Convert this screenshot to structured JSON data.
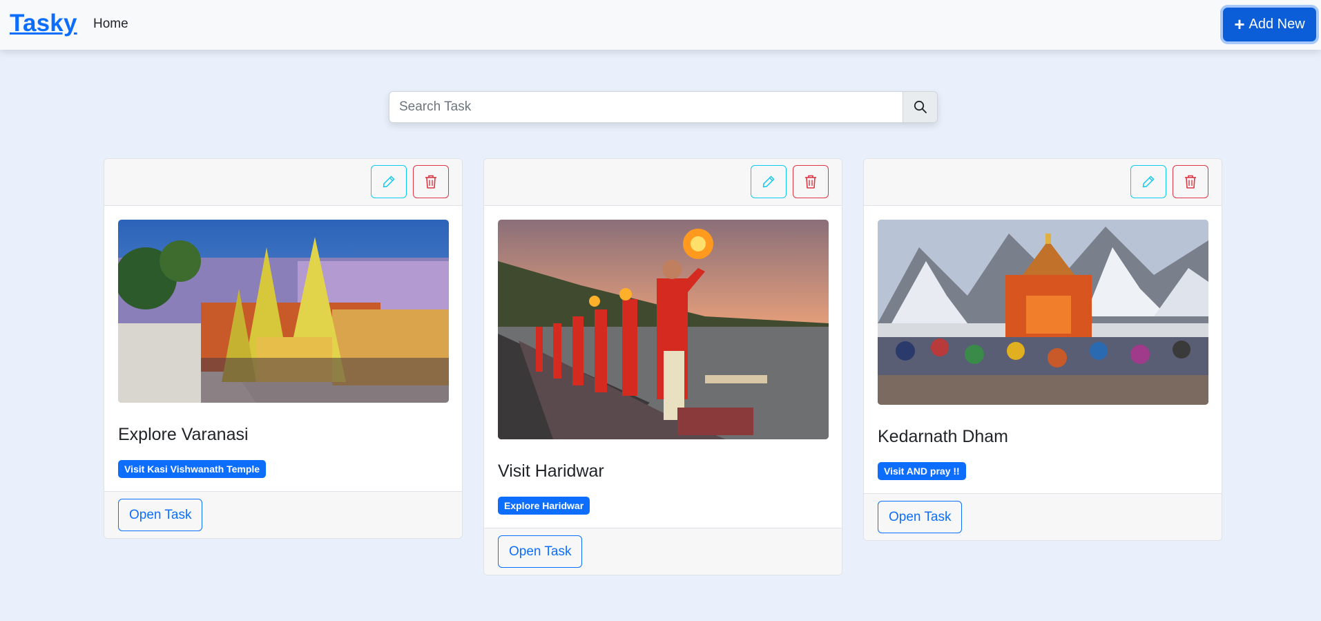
{
  "navbar": {
    "brand": "Tasky",
    "home_label": "Home",
    "add_new_label": "Add New",
    "add_new_icon": "plus-icon"
  },
  "search": {
    "placeholder": "Search Task",
    "value": "",
    "icon": "search-icon"
  },
  "colors": {
    "primary": "#0d6efd",
    "info": "#0dcaf0",
    "danger": "#dc3545",
    "page_bg": "#e9f0fc"
  },
  "tasks": [
    {
      "title": "Explore Varanasi",
      "tag": "Visit Kasi Vishwanath Temple",
      "open_label": "Open Task",
      "image_subject": "varanasi-temple-image"
    },
    {
      "title": "Visit Haridwar",
      "tag": "Explore Haridwar",
      "open_label": "Open Task",
      "image_subject": "haridwar-aarti-image"
    },
    {
      "title": "Kedarnath Dham",
      "tag": "Visit AND pray !!",
      "open_label": "Open Task",
      "image_subject": "kedarnath-temple-image"
    }
  ]
}
